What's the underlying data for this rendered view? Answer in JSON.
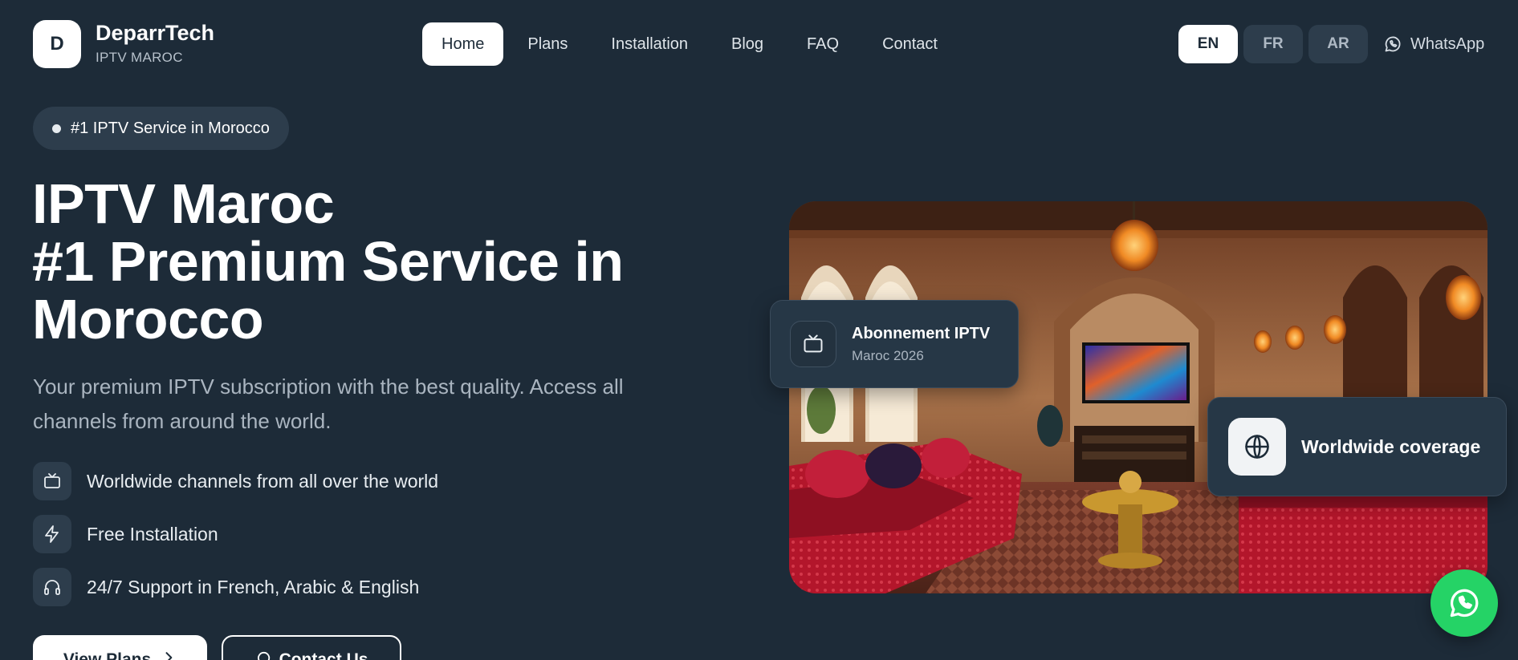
{
  "header": {
    "logo_letter": "D",
    "brand_name": "DeparrTech",
    "brand_sub": "IPTV MAROC",
    "nav": [
      {
        "label": "Home",
        "active": true
      },
      {
        "label": "Plans"
      },
      {
        "label": "Installation"
      },
      {
        "label": "Blog"
      },
      {
        "label": "FAQ"
      },
      {
        "label": "Contact"
      }
    ],
    "languages": [
      {
        "label": "EN",
        "active": true
      },
      {
        "label": "FR"
      },
      {
        "label": "AR"
      }
    ],
    "whatsapp_label": "WhatsApp"
  },
  "hero": {
    "badge": "#1 IPTV Service in Morocco",
    "title_lines": [
      "IPTV Maroc",
      "#1 Premium Service in",
      "Morocco"
    ],
    "description": "Your premium IPTV subscription with the best quality. Access all channels from around the world.",
    "features": [
      {
        "icon": "tv-icon",
        "text": "Worldwide channels from all over the world"
      },
      {
        "icon": "lightning-icon",
        "text": "Free Installation"
      },
      {
        "icon": "headphones-icon",
        "text": "24/7 Support in French, Arabic & English"
      }
    ],
    "cta_primary": "View Plans",
    "cta_secondary": "Contact Us"
  },
  "cards": {
    "card1_title": "Abonnement IPTV",
    "card1_sub": "Maroc 2026",
    "card2_title": "Worldwide coverage"
  },
  "colors": {
    "background": "#1d2b38",
    "surface": "#2d3d4c",
    "whatsapp": "#25d366"
  }
}
